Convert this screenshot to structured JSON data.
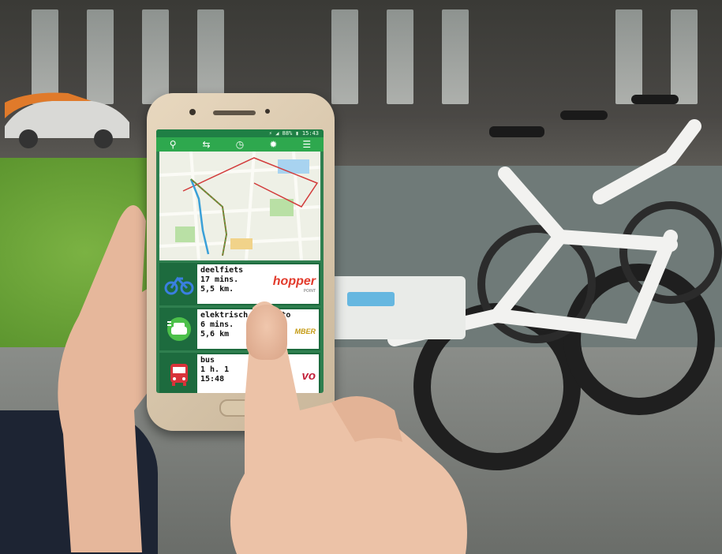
{
  "phone": {
    "status": "⚡ ◢ 88% ▮ 15:43",
    "nav_icons": [
      "map-pin-icon",
      "swap-icon",
      "clock-icon",
      "settings-icon",
      "menu-icon"
    ],
    "options": [
      {
        "name": "deelfiets",
        "time": "17 mins.",
        "distance": "5,5 km.",
        "brand": "hopper",
        "brand_sub": "POINT",
        "icon": "bicycle-icon"
      },
      {
        "name": "elektrisch deelauto",
        "time": "6 mins.",
        "distance": "5,6 km",
        "brand": "MBER",
        "icon": "electric-car-icon"
      },
      {
        "name": "bus",
        "time": "1 h. 1",
        "distance": "15:48",
        "brand": "vo",
        "icon": "bus-icon"
      }
    ]
  },
  "colors": {
    "app_green": "#2ea84e",
    "dark_green": "#1d6b3e",
    "route_blue": "#3aa0d8",
    "route_red": "#d23b3b"
  }
}
